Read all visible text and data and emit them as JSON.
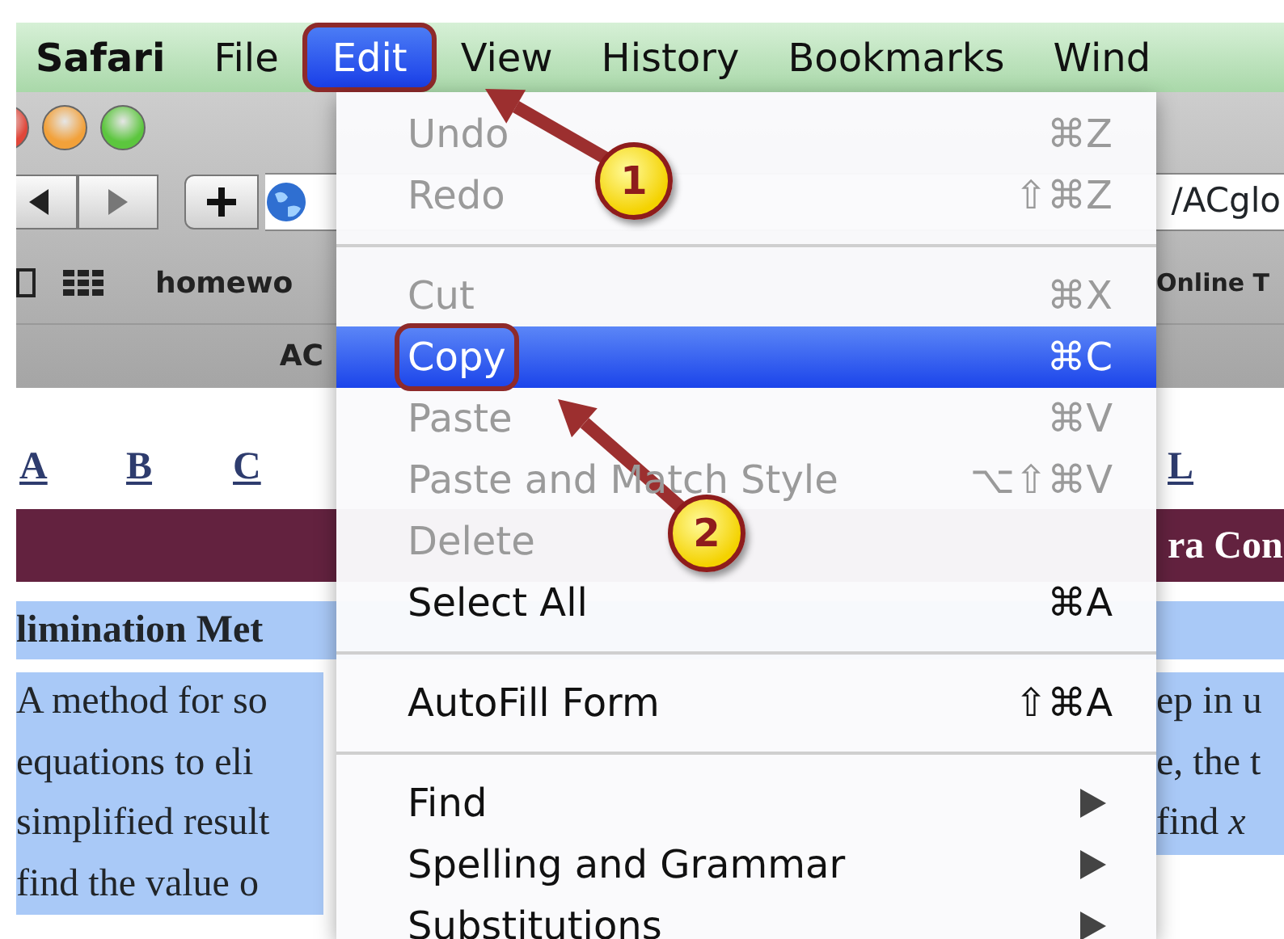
{
  "menubar": [
    {
      "label": "Safari",
      "kind": "app",
      "selected": false,
      "outlined": false
    },
    {
      "label": "File",
      "kind": "menu",
      "selected": false,
      "outlined": false
    },
    {
      "label": "Edit",
      "kind": "menu",
      "selected": true,
      "outlined": true
    },
    {
      "label": "View",
      "kind": "menu",
      "selected": false,
      "outlined": false
    },
    {
      "label": "History",
      "kind": "menu",
      "selected": false,
      "outlined": false
    },
    {
      "label": "Bookmarks",
      "kind": "menu",
      "selected": false,
      "outlined": false
    },
    {
      "label": "Wind",
      "kind": "menu",
      "selected": false,
      "outlined": false
    }
  ],
  "browser": {
    "address_field": {
      "value": "/ACglo"
    },
    "bookmarks_left": [
      "homewo"
    ],
    "bookmarks_right": [
      "Online T"
    ],
    "tab": {
      "label": "AC"
    }
  },
  "page": {
    "letter_links_left": [
      "A",
      "B",
      "C"
    ],
    "letter_links_right": [
      "L"
    ],
    "banner": "ra Con",
    "selection_highlighted": true,
    "heading": "limination Met",
    "paragraph_left": [
      "A method for so",
      "equations to eli",
      "simplified result",
      "find the value o"
    ],
    "paragraph_right": [
      "ep in u",
      "e, the t",
      "find *x*"
    ]
  },
  "edit_menu": {
    "items": [
      {
        "kind": "item",
        "label": "Undo",
        "shortcut": "⌘Z",
        "disabled": true,
        "selected": false,
        "outlined": false
      },
      {
        "kind": "item",
        "label": "Redo",
        "shortcut": "⇧⌘Z",
        "disabled": true,
        "selected": false,
        "outlined": false
      },
      {
        "kind": "separator"
      },
      {
        "kind": "item",
        "label": "Cut",
        "shortcut": "⌘X",
        "disabled": true,
        "selected": false,
        "outlined": false
      },
      {
        "kind": "item",
        "label": "Copy",
        "shortcut": "⌘C",
        "disabled": false,
        "selected": true,
        "outlined": true
      },
      {
        "kind": "item",
        "label": "Paste",
        "shortcut": "⌘V",
        "disabled": true,
        "selected": false,
        "outlined": false
      },
      {
        "kind": "item",
        "label": "Paste and Match Style",
        "shortcut": "⌥⇧⌘V",
        "disabled": true,
        "selected": false,
        "outlined": false
      },
      {
        "kind": "item",
        "label": "Delete",
        "disabled": true,
        "selected": false,
        "outlined": false
      },
      {
        "kind": "item",
        "label": "Select All",
        "shortcut": "⌘A",
        "disabled": false,
        "selected": false,
        "outlined": false
      },
      {
        "kind": "separator"
      },
      {
        "kind": "item",
        "label": "AutoFill Form",
        "shortcut": "⇧⌘A",
        "disabled": false,
        "selected": false,
        "outlined": false
      },
      {
        "kind": "separator"
      },
      {
        "kind": "submenu",
        "label": "Find",
        "disabled": false,
        "selected": false,
        "outlined": false
      },
      {
        "kind": "submenu",
        "label": "Spelling and Grammar",
        "disabled": false,
        "selected": false,
        "outlined": false
      },
      {
        "kind": "submenu",
        "label": "Substitutions",
        "disabled": false,
        "selected": false,
        "outlined": false
      }
    ]
  },
  "annotations": [
    {
      "text": "1"
    },
    {
      "text": "2"
    }
  ]
}
